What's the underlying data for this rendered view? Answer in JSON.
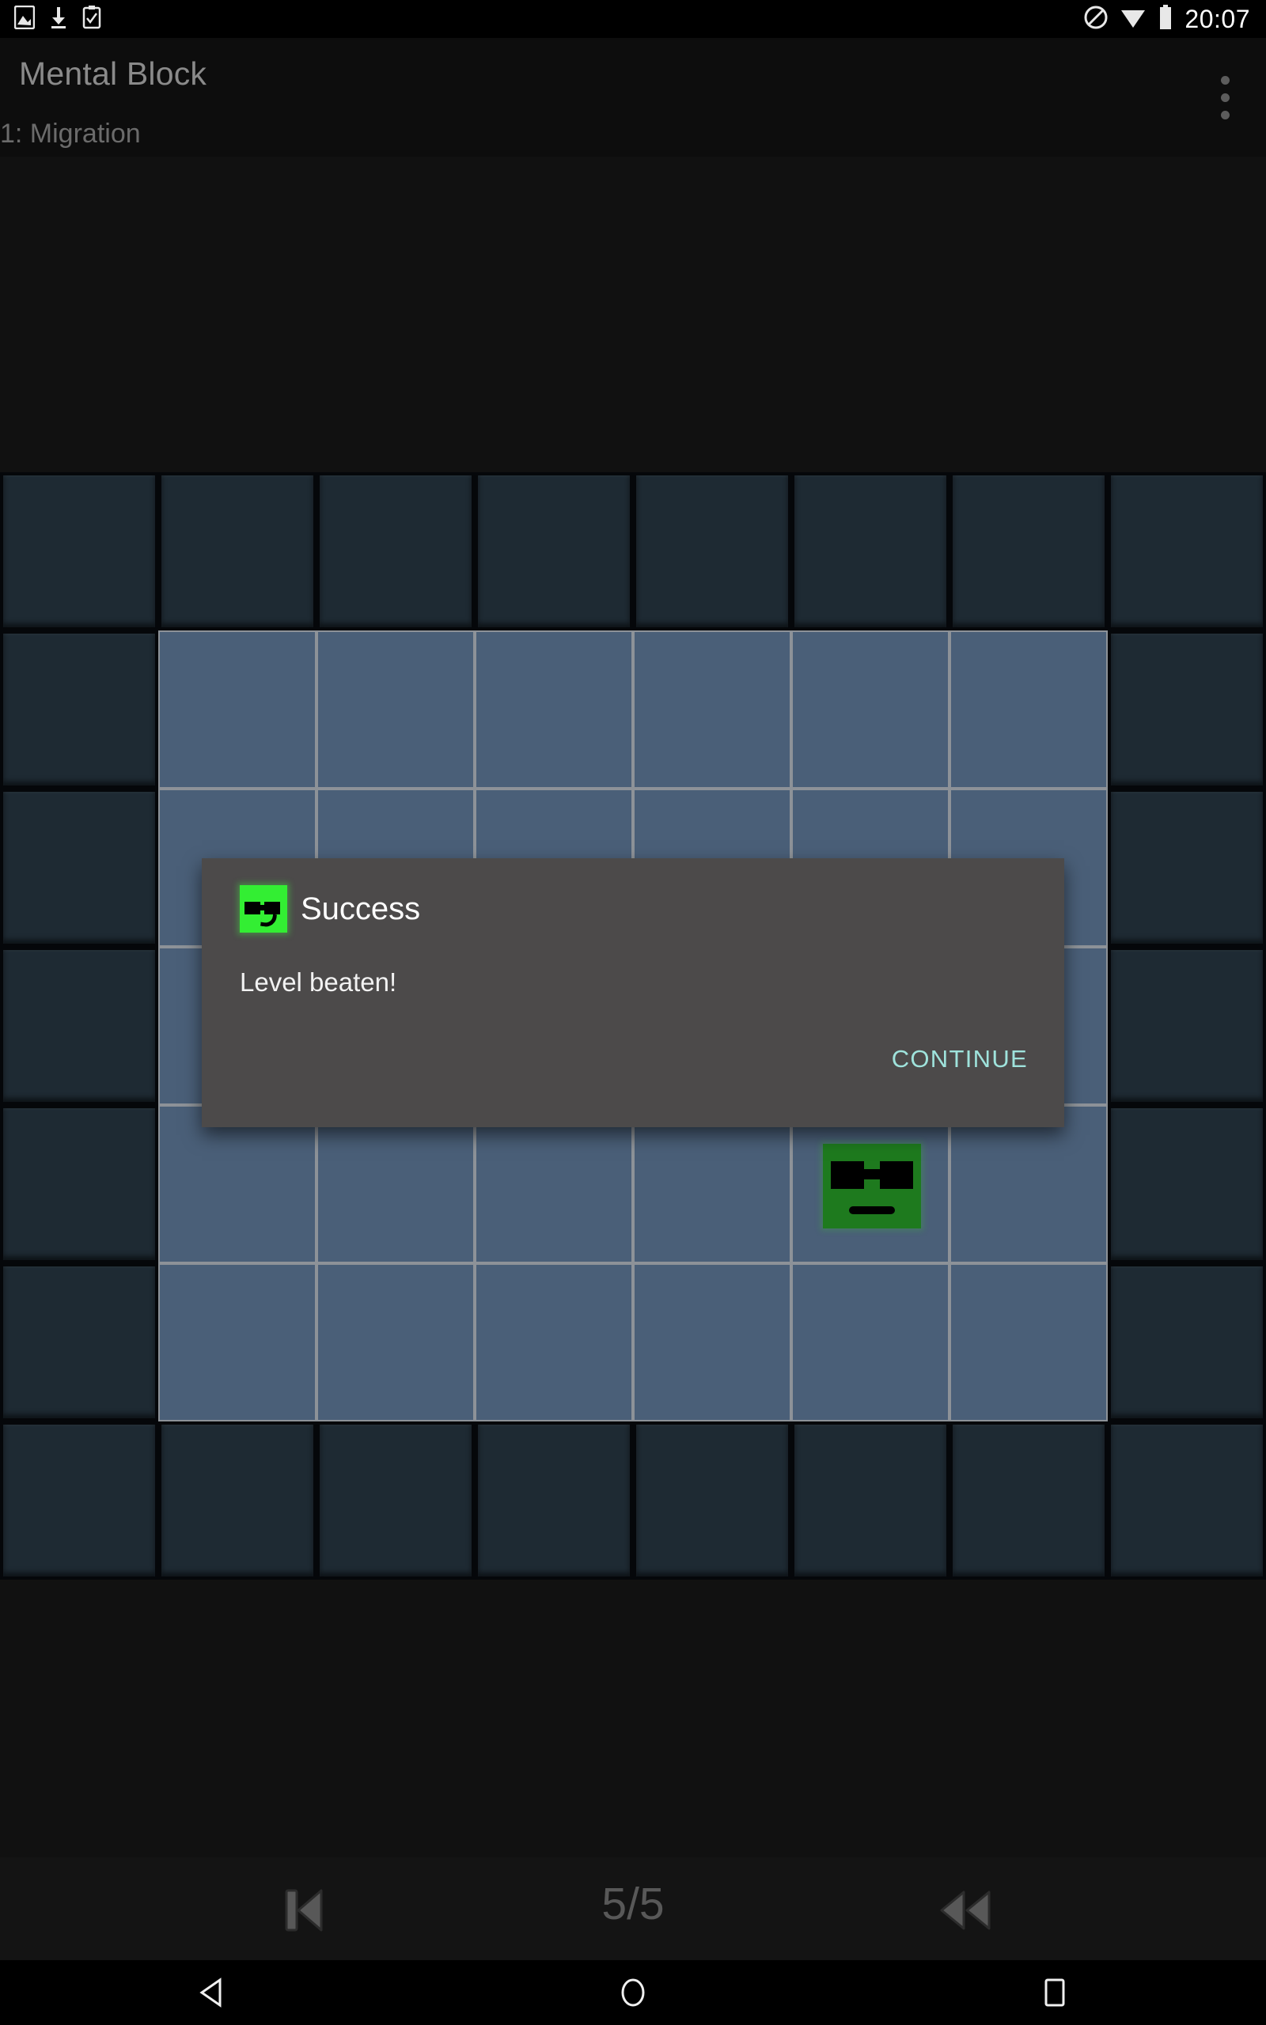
{
  "status_bar": {
    "icons_left": [
      "image-icon",
      "download-icon",
      "checkbox-note-icon"
    ],
    "icons_right": [
      "do-not-disturb-icon",
      "wifi-icon",
      "battery-icon"
    ],
    "time": "20:07"
  },
  "action_bar": {
    "title": "Mental Block",
    "overflow_icon": "overflow-menu-icon"
  },
  "level": {
    "name": "1: Migration"
  },
  "dialog": {
    "icon": "success-face-icon",
    "title": "Success",
    "message": "Level beaten!",
    "continue_label": "CONTINUE",
    "accent_color": "#9fe3dc",
    "background_color": "#4c4a4a"
  },
  "controls": {
    "restart_icon": "skip-to-start-icon",
    "undo_icon": "rewind-icon",
    "step_counter": "5/5"
  },
  "nav_bar": {
    "back_icon": "back-triangle-icon",
    "home_icon": "home-circle-icon",
    "recents_icon": "recents-square-icon"
  },
  "board": {
    "cols": 8,
    "rows": 7,
    "cell_size": 200,
    "wall_color": "#1e2a33",
    "floor_color": "#4a5f78",
    "player_color": "#1e7a1e",
    "grid": [
      [
        "wall",
        "wall",
        "wall",
        "wall",
        "wall",
        "wall",
        "wall",
        "wall"
      ],
      [
        "wall",
        "floor",
        "floor",
        "floor",
        "floor",
        "floor",
        "floor",
        "wall"
      ],
      [
        "wall",
        "floor",
        "floor",
        "floor",
        "floor",
        "floor",
        "floor",
        "wall"
      ],
      [
        "wall",
        "floor",
        "floor",
        "floor",
        "floor",
        "floor",
        "floor",
        "wall"
      ],
      [
        "wall",
        "floor",
        "floor",
        "floor",
        "floor",
        "player",
        "floor",
        "wall"
      ],
      [
        "wall",
        "floor",
        "floor",
        "floor",
        "floor",
        "floor",
        "floor",
        "wall"
      ],
      [
        "wall",
        "wall",
        "wall",
        "wall",
        "wall",
        "wall",
        "wall",
        "wall"
      ]
    ]
  }
}
